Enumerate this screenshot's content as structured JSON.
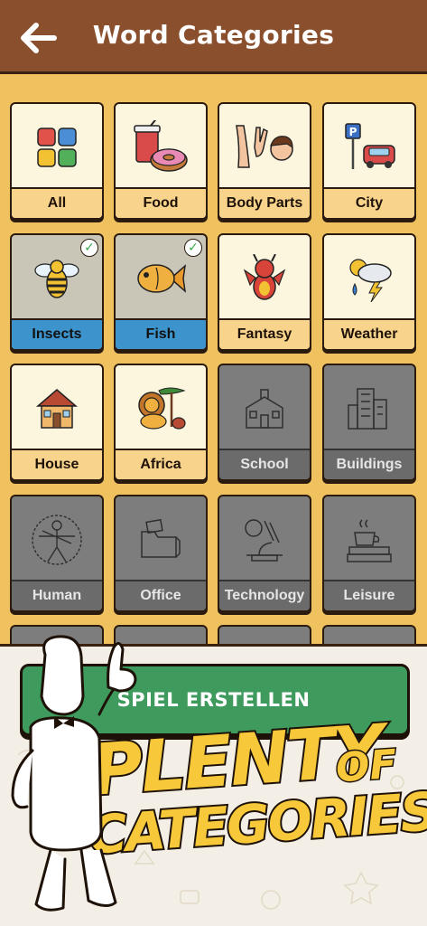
{
  "header": {
    "title": "Word Categories",
    "back_icon": "back-arrow-icon",
    "color": "#8a4f2c"
  },
  "categories": [
    {
      "label": "All",
      "icon": "grid-icon",
      "state": "available"
    },
    {
      "label": "Food",
      "icon": "food-icon",
      "state": "available"
    },
    {
      "label": "Body Parts",
      "icon": "body-parts-icon",
      "state": "available"
    },
    {
      "label": "City",
      "icon": "city-icon",
      "state": "available"
    },
    {
      "label": "Insects",
      "icon": "bee-icon",
      "state": "selected"
    },
    {
      "label": "Fish",
      "icon": "fish-icon",
      "state": "selected"
    },
    {
      "label": "Fantasy",
      "icon": "dragon-icon",
      "state": "available"
    },
    {
      "label": "Weather",
      "icon": "weather-icon",
      "state": "available"
    },
    {
      "label": "House",
      "icon": "house-icon",
      "state": "available"
    },
    {
      "label": "Africa",
      "icon": "lion-icon",
      "state": "available"
    },
    {
      "label": "School",
      "icon": "school-icon",
      "state": "locked"
    },
    {
      "label": "Buildings",
      "icon": "buildings-icon",
      "state": "locked"
    },
    {
      "label": "Human",
      "icon": "human-icon",
      "state": "locked"
    },
    {
      "label": "Office",
      "icon": "office-icon",
      "state": "locked"
    },
    {
      "label": "Technology",
      "icon": "microscope-icon",
      "state": "locked"
    },
    {
      "label": "Leisure",
      "icon": "coffee-book-icon",
      "state": "locked"
    }
  ],
  "create_button": {
    "label": "SPIEL ERSTELLEN",
    "color": "#3f9a5e"
  },
  "promo": {
    "line1": "PLENTY",
    "of": "OF",
    "line2": "CATEGORIES!"
  },
  "colors": {
    "background": "#efc15f",
    "selected": "#3d94cc",
    "locked": "#7d7d7d",
    "accent_text": "#f6c83a"
  }
}
